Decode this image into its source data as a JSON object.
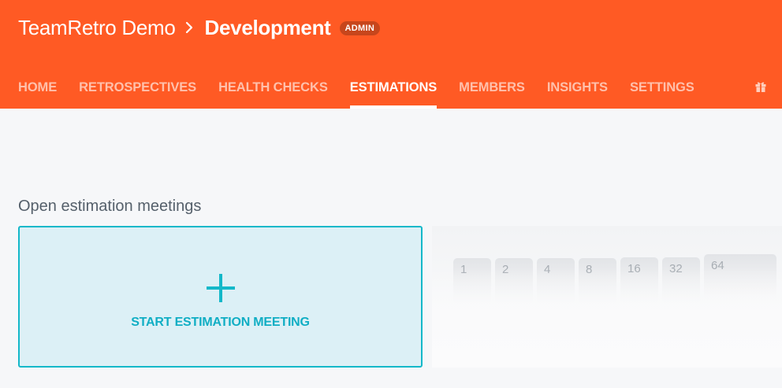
{
  "header": {
    "org_name": "TeamRetro Demo",
    "team_name": "Development",
    "role_badge": "ADMIN",
    "background_color": "#ff5a24"
  },
  "nav": {
    "tabs": [
      {
        "label": "HOME",
        "active": false
      },
      {
        "label": "RETROSPECTIVES",
        "active": false
      },
      {
        "label": "HEALTH CHECKS",
        "active": false
      },
      {
        "label": "ESTIMATIONS",
        "active": true
      },
      {
        "label": "MEMBERS",
        "active": false
      },
      {
        "label": "INSIGHTS",
        "active": false
      },
      {
        "label": "SETTINGS",
        "active": false
      }
    ],
    "extra_icon": "gift-icon"
  },
  "main": {
    "section_title": "Open estimation meetings",
    "start_card": {
      "icon": "plus-icon",
      "label": "START ESTIMATION MEETING",
      "accent_color": "#14b8c9"
    },
    "preview_cards": [
      "1",
      "2",
      "4",
      "8",
      "16",
      "32",
      "64"
    ]
  }
}
